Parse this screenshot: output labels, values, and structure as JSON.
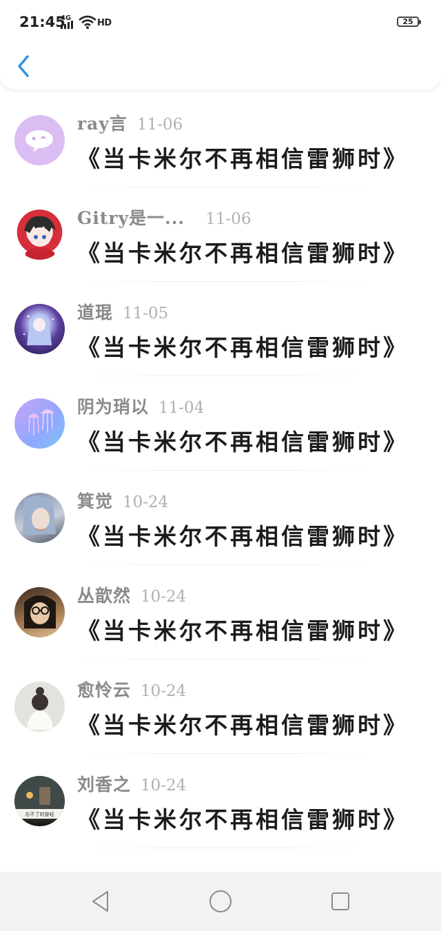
{
  "status_bar": {
    "time": "21:45",
    "network": "4G",
    "hd": "HD",
    "battery": "25",
    "icons": [
      "signal-icon",
      "wifi-icon",
      "battery-icon"
    ]
  },
  "header": {
    "back_icon": "chevron-left-icon",
    "accent_color": "#2f8fe0"
  },
  "list": {
    "items": [
      {
        "name": "ray言",
        "date": "11-06",
        "content": "《当卡米尔不再相信雷狮时》"
      },
      {
        "name": "Gitry是一...",
        "date": "11-06",
        "content": "《当卡米尔不再相信雷狮时》"
      },
      {
        "name": "道琨",
        "date": "11-05",
        "content": "《当卡米尔不再相信雷狮时》"
      },
      {
        "name": "阴为琑以",
        "date": "11-04",
        "content": "《当卡米尔不再相信雷狮时》"
      },
      {
        "name": "箕觉",
        "date": "10-24",
        "content": "《当卡米尔不再相信雷狮时》"
      },
      {
        "name": "丛歆然",
        "date": "10-24",
        "content": "《当卡米尔不再相信雷狮时》"
      },
      {
        "name": "愈怜云",
        "date": "10-24",
        "content": "《当卡米尔不再相信雷狮时》"
      },
      {
        "name": "刘香之",
        "date": "10-24",
        "content": "《当卡米尔不再相信雷狮时》",
        "avatar_caption": "忘不了的曾经"
      }
    ]
  },
  "nav_bar": {
    "icons": [
      "back-triangle-icon",
      "home-circle-icon",
      "recents-square-icon"
    ]
  }
}
